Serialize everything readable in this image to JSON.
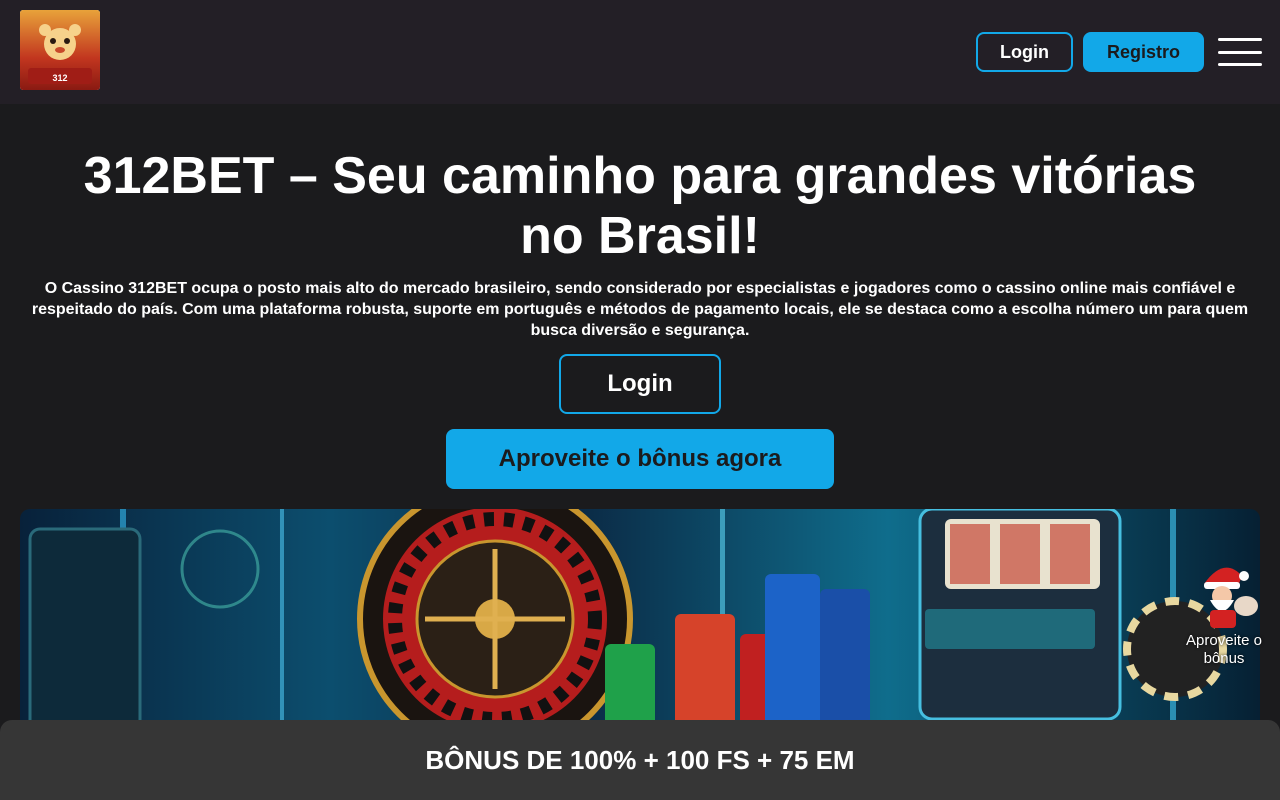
{
  "header": {
    "logo_text": "312",
    "login_label": "Login",
    "registro_label": "Registro"
  },
  "hero": {
    "title": "312BET – Seu caminho para grandes vitórias no Brasil!",
    "description": "O Cassino 312BET ocupa o posto mais alto do mercado brasileiro, sendo considerado por especialistas e jogadores como o cassino online mais confiável e respeitado do país. Com uma plataforma robusta, suporte em português e métodos de pagamento locais, ele se destaca como a escolha número um para quem busca diversão e segurança.",
    "login_label": "Login",
    "bonus_label": "Aproveite o bônus agora"
  },
  "floating": {
    "label": "Aproveite o bônus"
  },
  "bottom_bar": {
    "text": "BÔNUS DE 100% + 100 FS + 75 EM"
  },
  "colors": {
    "accent": "#12a8e8",
    "background": "#1b1b1d",
    "header": "#231f26",
    "bottom_bar": "#363636"
  },
  "icons": [
    "menu-icon",
    "santa-icon"
  ]
}
